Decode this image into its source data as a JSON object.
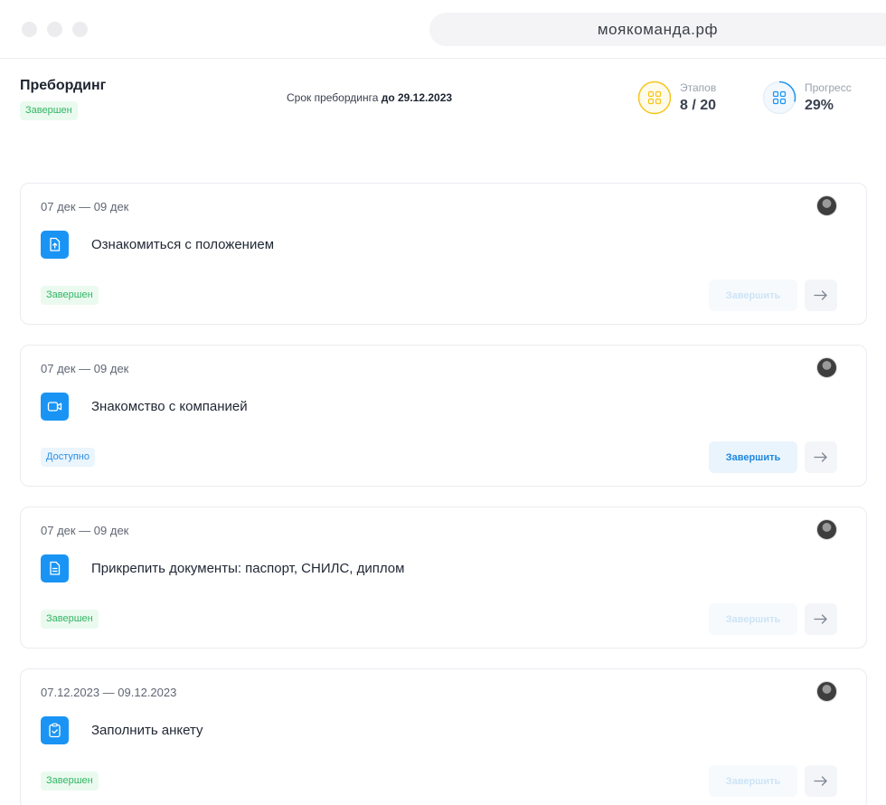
{
  "browser": {
    "url": "моякоманда.рф"
  },
  "header": {
    "title": "Пребординг",
    "status": "Завершен",
    "deadline_label": "Срок пребординга",
    "deadline_value": "до 29.12.2023"
  },
  "stats": {
    "stages": {
      "label": "Этапов",
      "value": "8 / 20",
      "icon": "grid-icon",
      "color": "#f6c51d"
    },
    "progress": {
      "label": "Прогресс",
      "value": "29%",
      "icon": "grid-icon",
      "color": "#1a94f4",
      "fraction": 0.29
    }
  },
  "tasks": [
    {
      "date": "07 дек — 09 дек",
      "title": "Ознакомиться с положением",
      "icon": "document-upload-icon",
      "status": "Завершен",
      "status_type": "done",
      "finish_label": "Завершить",
      "finish_enabled": false
    },
    {
      "date": "07 дек — 09 дек",
      "title": "Знакомство с компанией",
      "icon": "video-camera-icon",
      "status": "Доступно",
      "status_type": "available",
      "finish_label": "Завершить",
      "finish_enabled": true
    },
    {
      "date": "07 дек — 09 дек",
      "title": "Прикрепить документы: паспорт, СНИЛС, диплом",
      "icon": "document-text-icon",
      "status": "Завершен",
      "status_type": "done",
      "finish_label": "Завершить",
      "finish_enabled": false
    },
    {
      "date": "07.12.2023 — 09.12.2023",
      "title": "Заполнить анкету",
      "icon": "clipboard-check-icon",
      "status": "Завершен",
      "status_type": "done",
      "finish_label": "Завершить",
      "finish_enabled": false
    }
  ],
  "colors": {
    "accent": "#1a94f4",
    "done_text": "#33b564",
    "done_bg": "#eafaef",
    "available_text": "#2b8fe0",
    "available_bg": "#eaf5fe"
  }
}
